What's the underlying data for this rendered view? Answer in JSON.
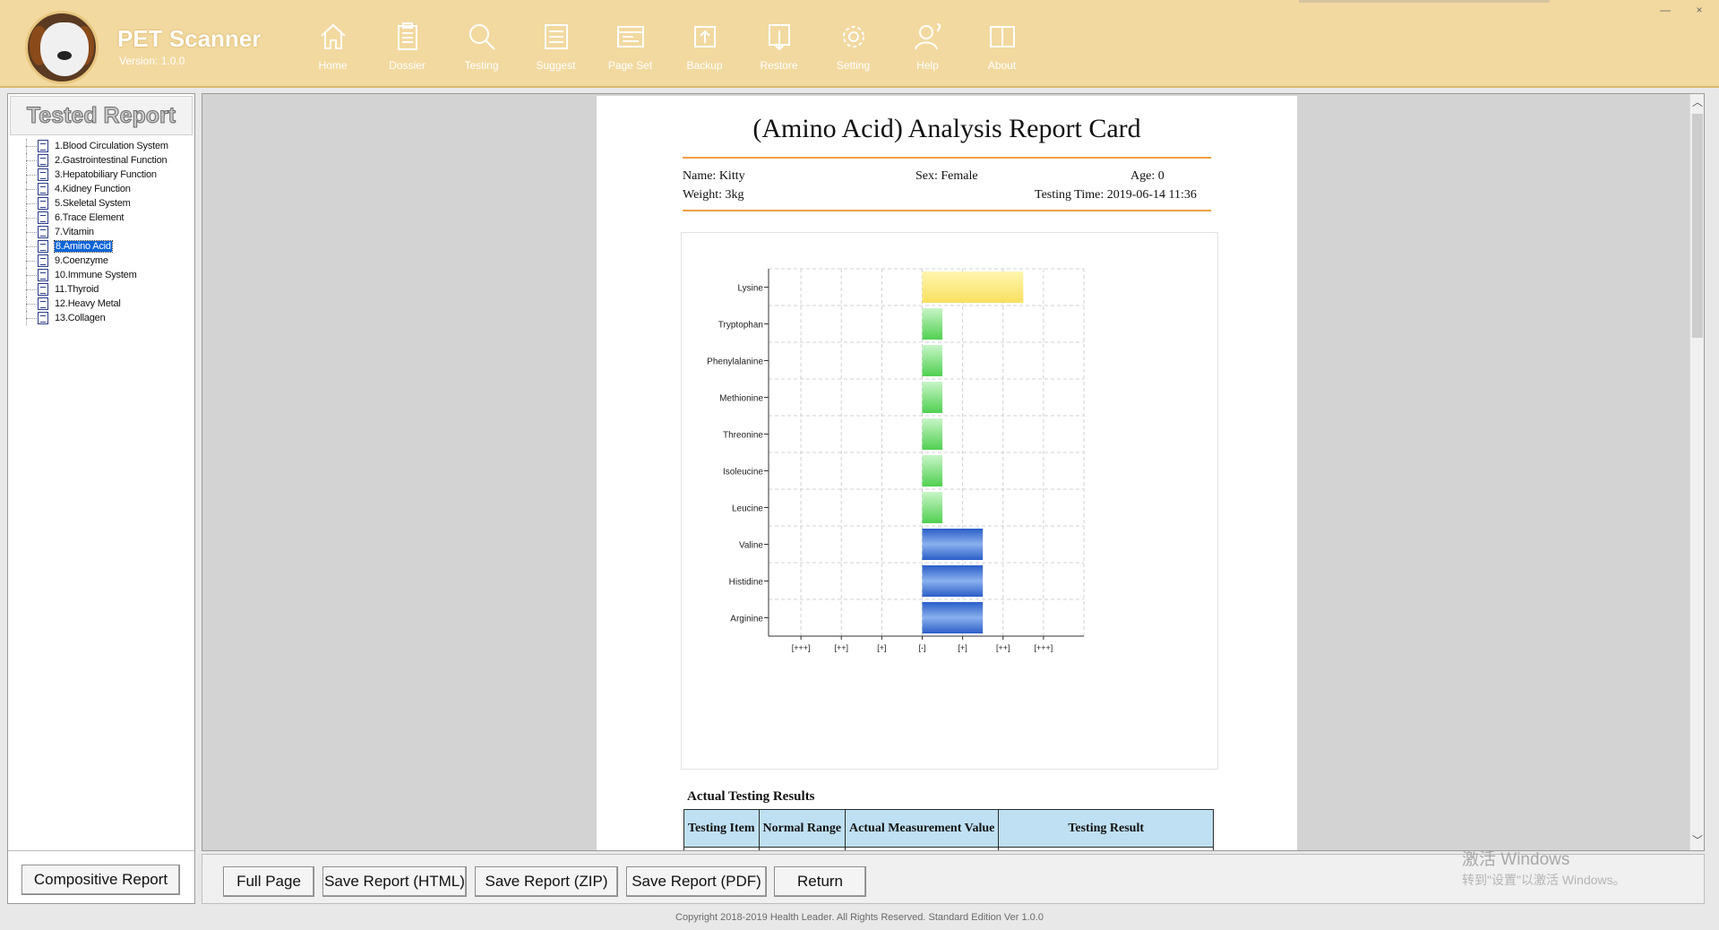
{
  "app": {
    "title": "PET Scanner",
    "version": "Version: 1.0.0",
    "nav": [
      {
        "label": "Home",
        "icon": "home-icon"
      },
      {
        "label": "Dossier",
        "icon": "clipboard-icon"
      },
      {
        "label": "Testing",
        "icon": "magnifier-icon"
      },
      {
        "label": "Suggest",
        "icon": "list-icon"
      },
      {
        "label": "Page Set",
        "icon": "page-setup-icon"
      },
      {
        "label": "Backup",
        "icon": "upload-icon"
      },
      {
        "label": "Restore",
        "icon": "download-icon"
      },
      {
        "label": "Setting",
        "icon": "gear-icon"
      },
      {
        "label": "Help",
        "icon": "help-person-icon"
      },
      {
        "label": "About",
        "icon": "book-icon"
      }
    ],
    "window_controls": {
      "minimize": "—",
      "close": "×"
    }
  },
  "sidebar": {
    "title": "Tested Report",
    "items": [
      "1.Blood Circulation System",
      "2.Gastrointestinal Function",
      "3.Hepatobiliary Function",
      "4.Kidney Function",
      "5.Skeletal System",
      "6.Trace Element",
      "7.Vitamin",
      "8.Amino Acid",
      "9.Coenzyme",
      "10.Immune System",
      "11.Thyroid",
      "12.Heavy Metal",
      "13.Collagen"
    ],
    "selected_index": 7,
    "composite_button": "Compositive Report"
  },
  "report": {
    "title": "(Amino Acid) Analysis Report Card",
    "name": "Name: Kitty",
    "sex": "Sex: Female",
    "age": "Age: 0",
    "weight": "Weight: 3kg",
    "testing_time": "Testing Time: 2019-06-14 11:36",
    "section_title": "Actual Testing Results",
    "table_headers": [
      "Testing Item",
      "Normal Range",
      "Actual Measurement Value",
      "Testing Result"
    ]
  },
  "chart_data": {
    "type": "bar",
    "orientation": "horizontal",
    "categories": [
      "Lysine",
      "Tryptophan",
      "Phenylalanine",
      "Methionine",
      "Threonine",
      "Isoleucine",
      "Leucine",
      "Valine",
      "Histidine",
      "Arginine"
    ],
    "values": [
      2.5,
      0.5,
      0.5,
      0.5,
      0.5,
      0.5,
      0.5,
      1.5,
      1.5,
      1.5
    ],
    "bar_colors": [
      "#f8e060",
      "#50d050",
      "#50d050",
      "#50d050",
      "#50d050",
      "#50d050",
      "#50d050",
      "#3a6fd8",
      "#3a6fd8",
      "#3a6fd8"
    ],
    "x_tick_labels": [
      "[+++]",
      "[++]",
      "[+]",
      "[-]",
      "[+]",
      "[++]",
      "[+++]"
    ],
    "x_tick_values": [
      -3,
      -2,
      -1,
      0,
      1,
      2,
      3
    ],
    "xlim": [
      -3.8,
      4
    ],
    "grid": true
  },
  "toolbar": {
    "full_page": "Full Page",
    "save_html": "Save Report (HTML)",
    "save_zip": "Save Report (ZIP)",
    "save_pdf": "Save Report (PDF)",
    "return": "Return"
  },
  "watermark": {
    "line1": "激活 Windows",
    "line2": "转到\"设置\"以激活 Windows。"
  },
  "footer": {
    "copyright": "Copyright 2018-2019 Health Leader. All Rights Reserved.  Standard Edition Ver 1.0.0"
  }
}
